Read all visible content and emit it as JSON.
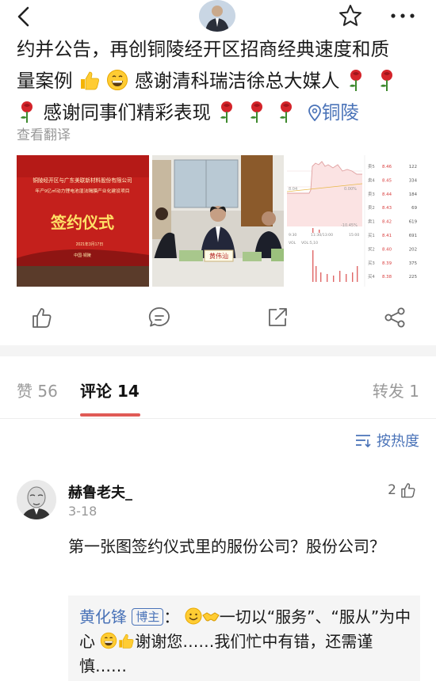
{
  "post": {
    "lines": [
      "约并公告，再创铜陵经开区招商经典速度和质",
      "量案例",
      "感谢清科瑞洁徐总大媒人",
      "感谢同事们精彩表现",
      "铜陵"
    ],
    "translate_label": "查看翻译"
  },
  "photos": {
    "photo1": {
      "line1": "铜陵经开区与广东美联新材料股份有限公司",
      "line2": "年产9亿㎡动力锂电池湿法隔膜产业化建设项目",
      "title": "签约仪式",
      "date": "2021年3月17日",
      "place": "中国·铜陵"
    },
    "photo2": {
      "nameplate": "黄伟汕"
    },
    "photo3": {
      "levels": [
        {
          "label": "卖5",
          "price": "8.46",
          "vol": "122"
        },
        {
          "label": "卖4",
          "price": "8.45",
          "vol": "334"
        },
        {
          "label": "卖3",
          "price": "8.44",
          "vol": "184"
        },
        {
          "label": "卖2",
          "price": "8.43",
          "vol": "69"
        },
        {
          "label": "卖1",
          "price": "8.42",
          "vol": "619"
        },
        {
          "label": "买1",
          "price": "8.41",
          "vol": "691"
        },
        {
          "label": "买2",
          "price": "8.40",
          "vol": "202"
        },
        {
          "label": "买3",
          "price": "8.39",
          "vol": "375"
        },
        {
          "label": "买4",
          "price": "8.38",
          "vol": "225"
        }
      ],
      "chart_labels": [
        "8.04",
        "0.00%",
        "-10.45%",
        "9:30",
        "11:30/13:00",
        "15:00",
        "VOL",
        "VOL:5,10"
      ]
    }
  },
  "tabs": {
    "likes": "赞 56",
    "comments": "评论 14",
    "reposts": "转发 1"
  },
  "sort_label": "按热度",
  "comment": {
    "name": "赫鲁老夫_",
    "date": "3-18",
    "likes": "2",
    "text": "第一张图签约仪式里的服份公司？股份公司？",
    "reply": {
      "author": "黄化锋",
      "badge": "博主",
      "colon": "：",
      "text_a": "一切以“服务”、“服从”为中心",
      "text_b": "谢谢您……我们忙中有错，还需谨慎……"
    }
  },
  "colors": {
    "link": "#4a73b8",
    "accent": "#e05a56",
    "muted": "#999999"
  }
}
